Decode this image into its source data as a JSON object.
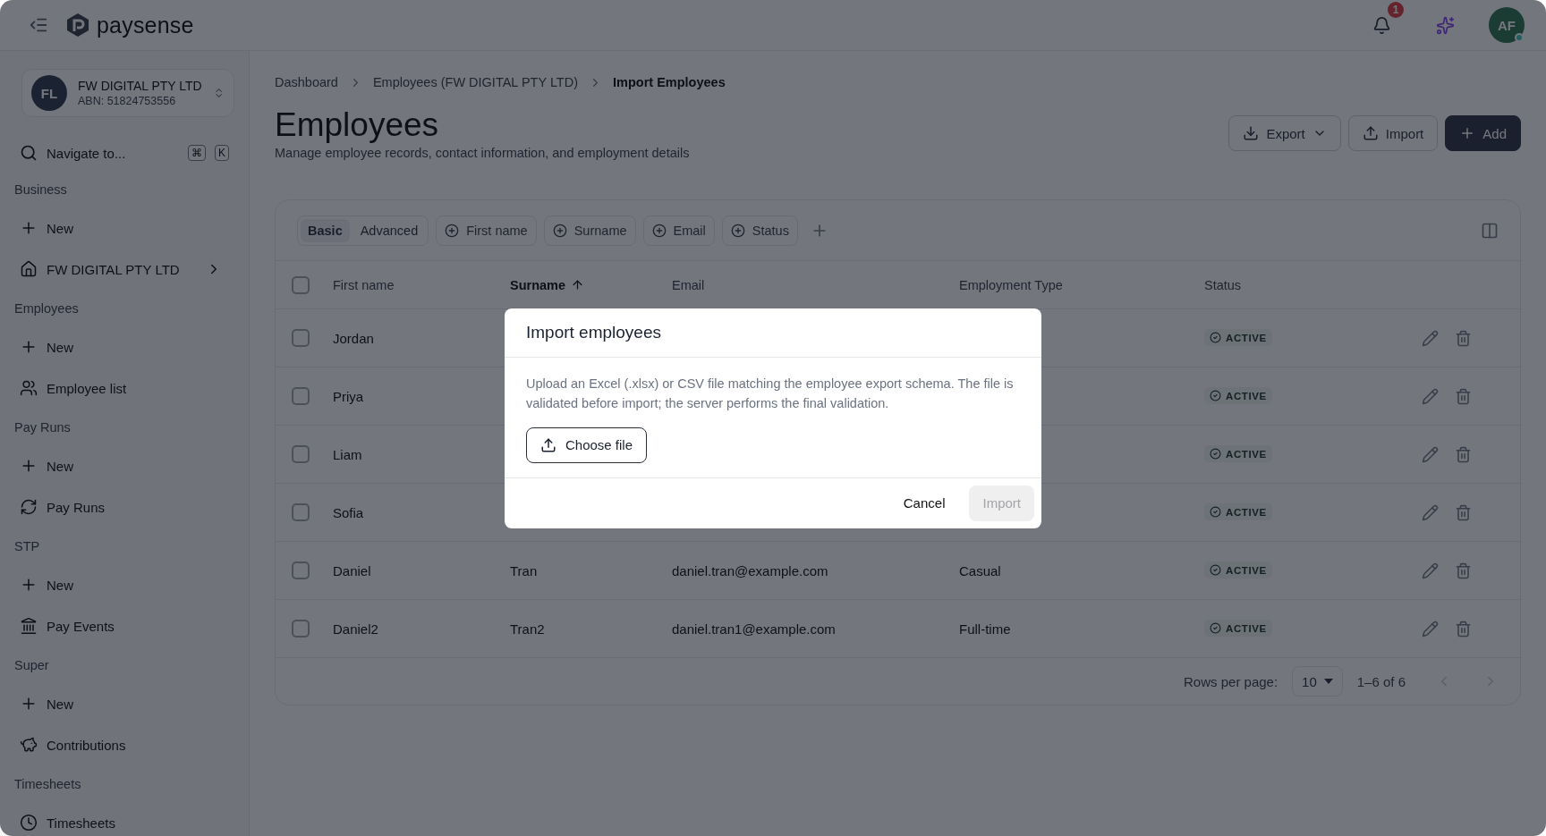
{
  "header": {
    "logo": "paysense",
    "notification_count": "1",
    "avatar": "AF",
    "online": true
  },
  "sidebar": {
    "company": {
      "initials": "FL",
      "name": "FW DIGITAL PTY LTD",
      "abn": "ABN: 51824753556"
    },
    "navigate": {
      "label": "Navigate to...",
      "keys": [
        "⌘",
        "K"
      ]
    },
    "sections": [
      {
        "title": "Business",
        "items": [
          {
            "label": "New",
            "kind": "new",
            "chevron": false
          },
          {
            "label": "FW DIGITAL PTY LTD",
            "kind": "business",
            "chevron": true
          }
        ]
      },
      {
        "title": "Employees",
        "items": [
          {
            "label": "New",
            "kind": "new",
            "chevron": false
          },
          {
            "label": "Employee list",
            "kind": "people",
            "chevron": false
          }
        ]
      },
      {
        "title": "Pay Runs",
        "items": [
          {
            "label": "New",
            "kind": "new",
            "chevron": false
          },
          {
            "label": "Pay Runs",
            "kind": "payrun",
            "chevron": false
          }
        ]
      },
      {
        "title": "STP",
        "items": [
          {
            "label": "New",
            "kind": "new",
            "chevron": false
          },
          {
            "label": "Pay Events",
            "kind": "events",
            "chevron": false
          }
        ]
      },
      {
        "title": "Super",
        "items": [
          {
            "label": "New",
            "kind": "new",
            "chevron": false
          },
          {
            "label": "Contributions",
            "kind": "super",
            "chevron": false
          }
        ]
      },
      {
        "title": "Timesheets",
        "items": [
          {
            "label": "Timesheets",
            "kind": "time",
            "chevron": false
          }
        ]
      }
    ]
  },
  "breadcrumb": [
    {
      "label": "Dashboard",
      "current": false
    },
    {
      "label": "Employees (FW DIGITAL PTY LTD)",
      "current": false
    },
    {
      "label": "Import Employees",
      "current": true
    }
  ],
  "page": {
    "title": "Employees",
    "subtitle": "Manage employee records, contact information, and employment details",
    "actions": [
      {
        "label": "Export",
        "kind": "export"
      },
      {
        "label": "Import",
        "kind": "import"
      },
      {
        "label": "Add",
        "kind": "add"
      }
    ]
  },
  "filters": {
    "modes": [
      {
        "label": "Basic",
        "selected": true
      },
      {
        "label": "Advanced",
        "selected": false
      }
    ],
    "chips": [
      "First name",
      "Surname",
      "Email",
      "Status"
    ]
  },
  "table": {
    "select_all_checked": false,
    "columns": [
      {
        "label": "First name",
        "sorted": false
      },
      {
        "label": "Surname",
        "sorted": true
      },
      {
        "label": "Email",
        "sorted": false
      },
      {
        "label": "Employment Type",
        "sorted": false
      },
      {
        "label": "Status",
        "sorted": false
      }
    ],
    "rows": [
      {
        "checked": false,
        "first_name": "Jordan",
        "status": "ACTIVE"
      },
      {
        "checked": false,
        "first_name": "Priya",
        "status": "ACTIVE"
      },
      {
        "checked": false,
        "first_name": "Liam",
        "status": "ACTIVE"
      },
      {
        "checked": false,
        "first_name": "Sofia",
        "status": "ACTIVE"
      },
      {
        "checked": false,
        "first_name": "Daniel",
        "surname": "Tran",
        "email": "daniel.tran@example.com",
        "employment_type": "Casual",
        "status": "ACTIVE"
      },
      {
        "checked": false,
        "first_name": "Daniel2",
        "surname": "Tran2",
        "email": "daniel.tran1@example.com",
        "employment_type": "Full-time",
        "status": "ACTIVE"
      }
    ]
  },
  "pagination": {
    "label": "Rows per page:",
    "rows_per_page": "10",
    "range": "1–6 of 6"
  },
  "dialog": {
    "title": "Import employees",
    "description": "Upload an Excel (.xlsx) or CSV file matching the employee export schema. The file is validated before import; the server performs the final validation.",
    "choose_file": "Choose file",
    "buttons": [
      {
        "label": "Cancel",
        "kind": "cancel",
        "disabled": false
      },
      {
        "label": "Import",
        "kind": "primary",
        "disabled": true
      }
    ]
  }
}
